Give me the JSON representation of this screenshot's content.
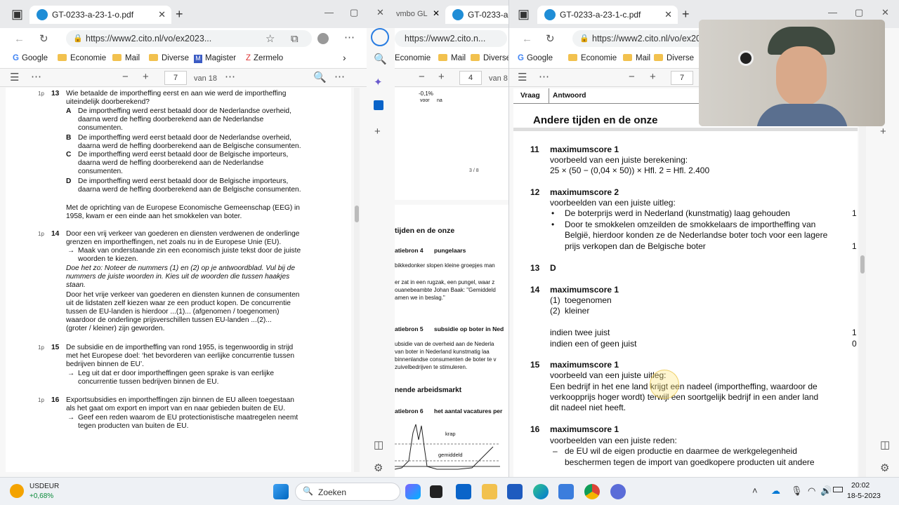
{
  "left": {
    "tab_title": "GT-0233-a-23-1-o.pdf",
    "url": "https://www2.cito.nl/vo/ex2023...",
    "bookmarks": [
      "Google",
      "Economie",
      "Mail",
      "Diverse",
      "Magister",
      "Zermelo"
    ],
    "page_current": "7",
    "page_total": "van 18",
    "q13": {
      "score": "1p",
      "num": "13",
      "q1": "Wie betaalde de importheffing eerst en aan wie werd de importheffing",
      "q2": "uiteindelijk doorberekend?",
      "A1": "De importheffing werd eerst betaald door de Nederlandse overheid,",
      "A2": "daarna werd de heffing doorberekend aan de Nederlandse",
      "A3": "consumenten.",
      "B1": "De importheffing werd eerst betaald door de Nederlandse overheid,",
      "B2": "daarna werd de heffing doorberekend aan de Belgische consumenten.",
      "C1": "De importheffing werd eerst betaald door de Belgische importeurs,",
      "C2": "daarna werd de heffing doorberekend aan de Nederlandse",
      "C3": "consumenten.",
      "D1": "De importheffing werd eerst betaald door de Belgische importeurs,",
      "D2": "daarna werd de heffing doorberekend aan de Belgische consumenten."
    },
    "intro1": "Met de oprichting van de Europese Economische Gemeenschap (EEG) in",
    "intro2": "1958, kwam er een einde aan het smokkelen van boter.",
    "q14": {
      "score": "1p",
      "num": "14",
      "l1": "Door een vrij verkeer van goederen en diensten verdwenen de onderlinge",
      "l2": "grenzen en importheffingen, net zoals nu in de Europese Unie (EU).",
      "l3": "Maak van onderstaande zin een economisch juiste tekst door de juiste",
      "l4": "woorden te kiezen.",
      "i1": "Doe het zo: Noteer de nummers (1) en (2) op je antwoordblad. Vul bij de",
      "i2": "nummers de juiste woorden in. Kies uit de woorden die tussen haakjes",
      "i3": "staan.",
      "l5": "Door het vrije verkeer van goederen en diensten kunnen de consumenten",
      "l6": "uit de lidstaten zelf kiezen waar ze een product kopen. De concurrentie",
      "l7": "tussen de EU-landen is hierdoor ...(1)... (afgenomen / toegenomen)",
      "l8": "waardoor de onderlinge prijsverschillen tussen EU-landen ...(2)...",
      "l9": "(groter / kleiner) zijn geworden."
    },
    "q15": {
      "score": "1p",
      "num": "15",
      "l1": "De subsidie en de importheffing van rond 1955, is tegenwoordig in strijd",
      "l2": "met het Europese doel: ‘het bevorderen van eerlijke concurrentie tussen",
      "l3": "bedrijven binnen de EU’.",
      "l4": "Leg uit dat er door importheffingen geen sprake is van eerlijke",
      "l5": "concurrentie tussen bedrijven binnen de EU."
    },
    "q16": {
      "score": "1p",
      "num": "16",
      "l1": "Exportsubsidies en importheffingen zijn binnen de EU alleen toegestaan",
      "l2": "als het gaat om export en import van en naar gebieden buiten de EU.",
      "l3": "Geef een reden waarom de EU protectionistische maatregelen neemt",
      "l4": "tegen producten van buiten de EU."
    }
  },
  "middle": {
    "tab1": "vmbo GL",
    "tab2": "GT-0233-a-23",
    "url": "https://www2.cito.n...",
    "bookmarks": [
      "Economie",
      "Mail",
      "Diverse"
    ],
    "page_current": "4",
    "page_total": "van 8",
    "pct": "-0,1%",
    "voor": "voor",
    "na": "na",
    "page_label": "3 / 8",
    "section_title": "tijden en de onze",
    "bron4_label": "atiebron 4",
    "bron4_title": "pungelaars",
    "bron4_l1": "bikkedonker slopen kleine groepjes man",
    "bron4_l2": "er zat in een rugzak, een pungel, waar z",
    "bron4_l3": "ouanebeambte Johan Baak: \"Gemiddeld",
    "bron4_l4": "amen we in beslag.\"",
    "bron5_label": "atiebron 5",
    "bron5_title": "subsidie op boter in Ned",
    "bron5_l1": "ubsidie van de overheid aan de Nederla",
    "bron5_l2": "van boter in Nederland kunstmatig laa",
    "bron5_l3": "binnenlandse consumenten de boter te v",
    "bron5_l4": "zuivelbedrijven te stimuleren.",
    "section2": "nende arbeidsmarkt",
    "bron6_label": "atiebron 6",
    "bron6_title": "het aantal vacatures per",
    "krap": "krap",
    "gemiddeld": "gemiddeld"
  },
  "right": {
    "tab_title": "GT-0233-a-23-1-c.pdf",
    "url": "https://www2.cito.nl/vo/ex20",
    "bookmarks": [
      "Google",
      "Economie",
      "Mail",
      "Diverse"
    ],
    "page_current": "7",
    "col_vraag": "Vraag",
    "col_antwoord": "Antwoord",
    "heading": "Andere tijden en de onze",
    "a11": {
      "num": "11",
      "title": "maximumscore 1",
      "l1": "voorbeeld van een juiste berekening:",
      "l2": "25 × (50 − (0,04 × 50)) × Hfl. 2 = Hfl. 2.400"
    },
    "a12": {
      "num": "12",
      "title": "maximumscore 2",
      "l1": "voorbeelden van een juiste uitleg:",
      "b1": "De boterprijs werd in Nederland (kunstmatig) laag gehouden",
      "p1": "1",
      "b2a": "Door te smokkelen omzeilden de smokkelaars de importheffing van",
      "b2b": "België, hierdoor konden ze de Nederlandse boter toch voor een lagere",
      "b2c": "prijs verkopen dan de Belgische boter",
      "p2": "1"
    },
    "a13": {
      "num": "13",
      "answer": "D"
    },
    "a14": {
      "num": "14",
      "title": "maximumscore 1",
      "l1": "(1)",
      "l1b": "toegenomen",
      "l2": "(2)",
      "l2b": "kleiner",
      "r1": "indien twee juist",
      "r1p": "1",
      "r2": "indien een of geen juist",
      "r2p": "0"
    },
    "a15": {
      "num": "15",
      "title": "maximumscore 1",
      "l1": "voorbeeld van een juiste uitleg:",
      "l2": "Een bedrijf in het ene land krijgt een nadeel (importheffing, waardoor de",
      "l3": "verkoopprijs hoger wordt) terwijl een soortgelijk bedrijf in een ander land",
      "l4": "dit nadeel niet heeft."
    },
    "a16": {
      "num": "16",
      "title": "maximumscore 1",
      "l1": "voorbeelden van een juiste reden:",
      "b1": "de EU wil de eigen productie en daarmee de werkgelegenheid",
      "b2": "beschermen tegen de import van goedkopere producten uit andere"
    }
  },
  "taskbar": {
    "ticker": "USDEUR",
    "change": "+0,68%",
    "search_placeholder": "Zoeken",
    "time": "20:02",
    "date": "18-5-2023"
  }
}
